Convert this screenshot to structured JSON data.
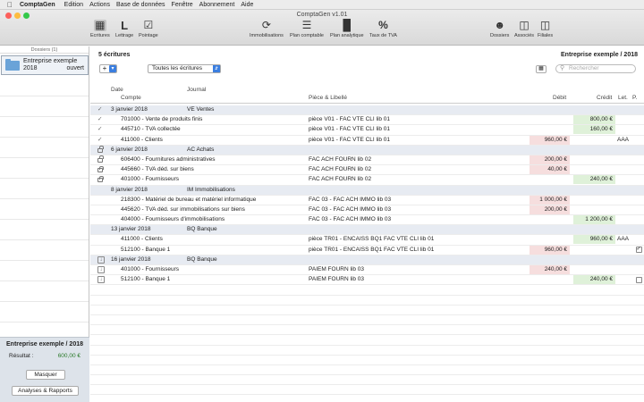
{
  "menubar": {
    "app": "ComptaGen",
    "items": [
      "Edition",
      "Actions",
      "Base de données",
      "Fenêtre",
      "Abonnement",
      "Aide"
    ]
  },
  "window": {
    "title": "ComptaGen v1.01"
  },
  "toolbar": {
    "ecritures": "Ecritures",
    "lettrage": "Lettrage",
    "pointage": "Pointage",
    "immobilisations": "Immobilisations",
    "plan_comptable": "Plan comptable",
    "plan_analytique": "Plan analytique",
    "taux_tva": "Taux de TVA",
    "dossiers": "Dossiers",
    "associes": "Associés",
    "filiales": "Filiales"
  },
  "sidebar": {
    "header": "Dossiers (1)",
    "dossier": {
      "name": "Entreprise exemple",
      "year": "2018",
      "status": "ouvert"
    },
    "footer": {
      "entreprise": "Entreprise exemple / 2018",
      "resultat_label": "Résultat :",
      "resultat_value": "600,00 €",
      "masquer": "Masquer",
      "analyses": "Analyses & Rapports"
    }
  },
  "main": {
    "count": "5 écritures",
    "title": "Entreprise exemple / 2018",
    "add": "+",
    "filter": "Toutes les écritures",
    "search_placeholder": "Rechercher",
    "columns": {
      "date": "Date",
      "journal": "Journal",
      "compte": "Compte",
      "piece": "Pièce & Libellé",
      "debit": "Débit",
      "credit": "Crédit",
      "let": "Let.",
      "p": "P."
    }
  },
  "rows": [
    {
      "type": "group",
      "icon": "check",
      "date": "3 janvier 2018",
      "journal": "VE Ventes"
    },
    {
      "type": "line",
      "icon": "check",
      "compte": "701000 - Vente de produits finis",
      "piece": "pièce V01 - FAC VTE CLI lib 01",
      "debit": "",
      "credit": "800,00 €",
      "let": "",
      "p": ""
    },
    {
      "type": "line",
      "icon": "check",
      "compte": "445710 - TVA collectée",
      "piece": "pièce V01 - FAC VTE CLI lib 01",
      "debit": "",
      "credit": "160,00 €",
      "let": "",
      "p": ""
    },
    {
      "type": "line",
      "icon": "check",
      "compte": "411000 - Clients",
      "piece": "pièce V01 - FAC VTE CLI lib 01",
      "debit": "960,00 €",
      "credit": "",
      "let": "AAA",
      "p": ""
    },
    {
      "type": "group",
      "icon": "lock",
      "date": "6 janvier 2018",
      "journal": "AC Achats"
    },
    {
      "type": "line",
      "icon": "lock",
      "compte": "606400 - Fournitures administratives",
      "piece": "FAC ACH FOURN lib 02",
      "debit": "200,00 €",
      "credit": "",
      "let": "",
      "p": ""
    },
    {
      "type": "line",
      "icon": "lock",
      "compte": "445660 - TVA déd. sur biens",
      "piece": "FAC ACH FOURN lib 02",
      "debit": "40,00 €",
      "credit": "",
      "let": "",
      "p": ""
    },
    {
      "type": "line",
      "icon": "lock",
      "compte": "401000 - Fournisseurs",
      "piece": "FAC ACH FOURN lib 02",
      "debit": "",
      "credit": "240,00 €",
      "let": "",
      "p": ""
    },
    {
      "type": "group",
      "icon": "",
      "date": "8 janvier 2018",
      "journal": "IM Immobilisations"
    },
    {
      "type": "line",
      "icon": "",
      "compte": "218300 - Matériel de bureau et matériel informatique",
      "piece": "FAC 03 - FAC ACH IMMO lib 03",
      "debit": "1 000,00 €",
      "credit": "",
      "let": "",
      "p": ""
    },
    {
      "type": "line",
      "icon": "",
      "compte": "445620 - TVA déd. sur immobilisations sur biens",
      "piece": "FAC 03 - FAC ACH IMMO lib 03",
      "debit": "200,00 €",
      "credit": "",
      "let": "",
      "p": ""
    },
    {
      "type": "line",
      "icon": "",
      "compte": "404000 - Fournisseurs d'immobilisations",
      "piece": "FAC 03 - FAC ACH IMMO lib 03",
      "debit": "",
      "credit": "1 200,00 €",
      "let": "",
      "p": ""
    },
    {
      "type": "group",
      "icon": "",
      "date": "13 janvier 2018",
      "journal": "BQ Banque"
    },
    {
      "type": "line",
      "icon": "",
      "compte": "411000 - Clients",
      "piece": "pièce TR01 - ENCAISS BQ1 FAC VTE CLI lib 01",
      "debit": "",
      "credit": "960,00 €",
      "let": "AAA",
      "p": ""
    },
    {
      "type": "line",
      "icon": "",
      "compte": "512100 - Banque 1",
      "piece": "pièce TR01 - ENCAISS BQ1 FAC VTE CLI lib 01",
      "debit": "960,00 €",
      "credit": "",
      "let": "",
      "p": "checked"
    },
    {
      "type": "group",
      "icon": "download",
      "date": "16 janvier 2018",
      "journal": "BQ Banque"
    },
    {
      "type": "line",
      "icon": "download",
      "compte": "401000 - Fournisseurs",
      "piece": "PAIEM FOURN lib 03",
      "debit": "240,00 €",
      "credit": "",
      "let": "",
      "p": ""
    },
    {
      "type": "line",
      "icon": "download",
      "compte": "512100 - Banque 1",
      "piece": "PAIEM FOURN lib 03",
      "debit": "",
      "credit": "240,00 €",
      "let": "",
      "p": "unchecked"
    }
  ]
}
